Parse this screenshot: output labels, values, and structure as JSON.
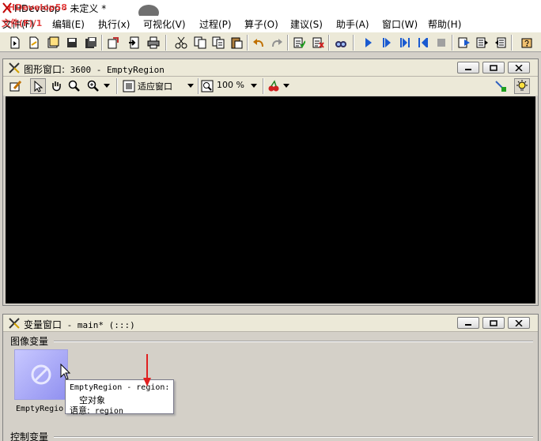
{
  "window": {
    "title": "HDevelop - 未定义 *",
    "watermark_1": "HDevelop58",
    "watermark_2": "文件(F)/1"
  },
  "menubar": {
    "items": [
      {
        "label": "文件(F)"
      },
      {
        "label": "编辑(E)"
      },
      {
        "label": "执行(x)"
      },
      {
        "label": "可视化(V)"
      },
      {
        "label": "过程(P)"
      },
      {
        "label": "算子(O)"
      },
      {
        "label": "建议(S)"
      },
      {
        "label": "助手(A)"
      },
      {
        "label": "窗口(W)"
      },
      {
        "label": "帮助(H)"
      }
    ]
  },
  "toolbar": {
    "icons": [
      "new-file-icon",
      "open-file-icon",
      "open-example-icon",
      "save-icon",
      "save-all-icon",
      "export-icon",
      "insert-code-icon",
      "print-icon",
      "cut-icon",
      "copy-icon",
      "copy-2-icon",
      "paste-icon",
      "undo-icon",
      "redo-icon",
      "activate-icon",
      "deactivate-icon",
      "profiler-icon",
      "run-icon",
      "step-over-icon",
      "step-into-icon",
      "step-out-icon",
      "stop-icon",
      "reset-program-icon",
      "reset-step-icon",
      "reset-all-icon",
      "help-icon"
    ]
  },
  "graphics_window": {
    "title_cjk": "图形窗口:",
    "title_rest": " 3600 - EmptyRegion",
    "fit_label": "适应窗口",
    "zoom_value": "100 %",
    "canvas_color": "#000000"
  },
  "variable_window": {
    "title_cjk": "变量窗口",
    "title_rest": " - main* (:::)",
    "iconic_group": "图像变量",
    "control_group": "控制变量",
    "iconic_variables": [
      {
        "name": "EmptyRegio"
      }
    ],
    "tooltip": {
      "line1": "EmptyRegion - region:",
      "line2": "空对象",
      "line3_label": "语意:",
      "line3_value": " region"
    }
  },
  "colors": {
    "menubar_bg": "#ffffff",
    "toolbar_bg": "#ece9d8",
    "window_bg": "#d4d0c8",
    "annotation_arrow": "#e02020"
  }
}
